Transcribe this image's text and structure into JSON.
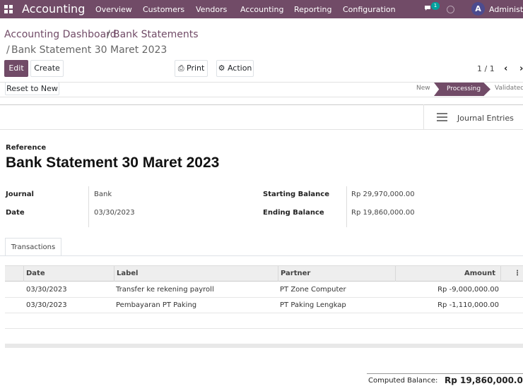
{
  "navbar": {
    "brand": "Accounting",
    "menu": [
      "Overview",
      "Customers",
      "Vendors",
      "Accounting",
      "Reporting",
      "Configuration"
    ],
    "chat_badge": "1",
    "user_initial": "A",
    "user_name": "Administrator"
  },
  "breadcrumb": {
    "parent1": "Accounting Dashboard",
    "parent2": "Bank Statements",
    "current": "Bank Statement 30 Maret 2023"
  },
  "toolbar": {
    "edit": "Edit",
    "create": "Create",
    "print": "Print",
    "action": "Action",
    "pager": "1 / 1"
  },
  "statusbar": {
    "reset": "Reset to New",
    "stages": [
      "New",
      "Processing",
      "Validated"
    ],
    "active_stage": "Processing"
  },
  "smart_button": {
    "journal_entries": "Journal Entries"
  },
  "form": {
    "reference_label": "Reference",
    "reference": "Bank Statement 30 Maret 2023",
    "journal_label": "Journal",
    "journal": "Bank",
    "date_label": "Date",
    "date": "03/30/2023",
    "starting_balance_label": "Starting Balance",
    "starting_balance": "Rp 29,970,000.00",
    "ending_balance_label": "Ending Balance",
    "ending_balance": "Rp 19,860,000.00"
  },
  "tabs": {
    "transactions": "Transactions"
  },
  "table": {
    "headers": {
      "date": "Date",
      "label": "Label",
      "partner": "Partner",
      "amount": "Amount"
    },
    "rows": [
      {
        "date": "03/30/2023",
        "label": "Transfer ke rekening payroll",
        "partner": "PT Zone Computer",
        "amount": "Rp -9,000,000.00"
      },
      {
        "date": "03/30/2023",
        "label": "Pembayaran PT Paking",
        "partner": "PT Paking Lengkap",
        "amount": "Rp -1,110,000.00"
      }
    ]
  },
  "footer": {
    "computed_label": "Computed Balance:",
    "computed_value": "Rp 19,860,000.00"
  },
  "colors": {
    "brand": "#714b67",
    "badge": "#00a09d"
  }
}
